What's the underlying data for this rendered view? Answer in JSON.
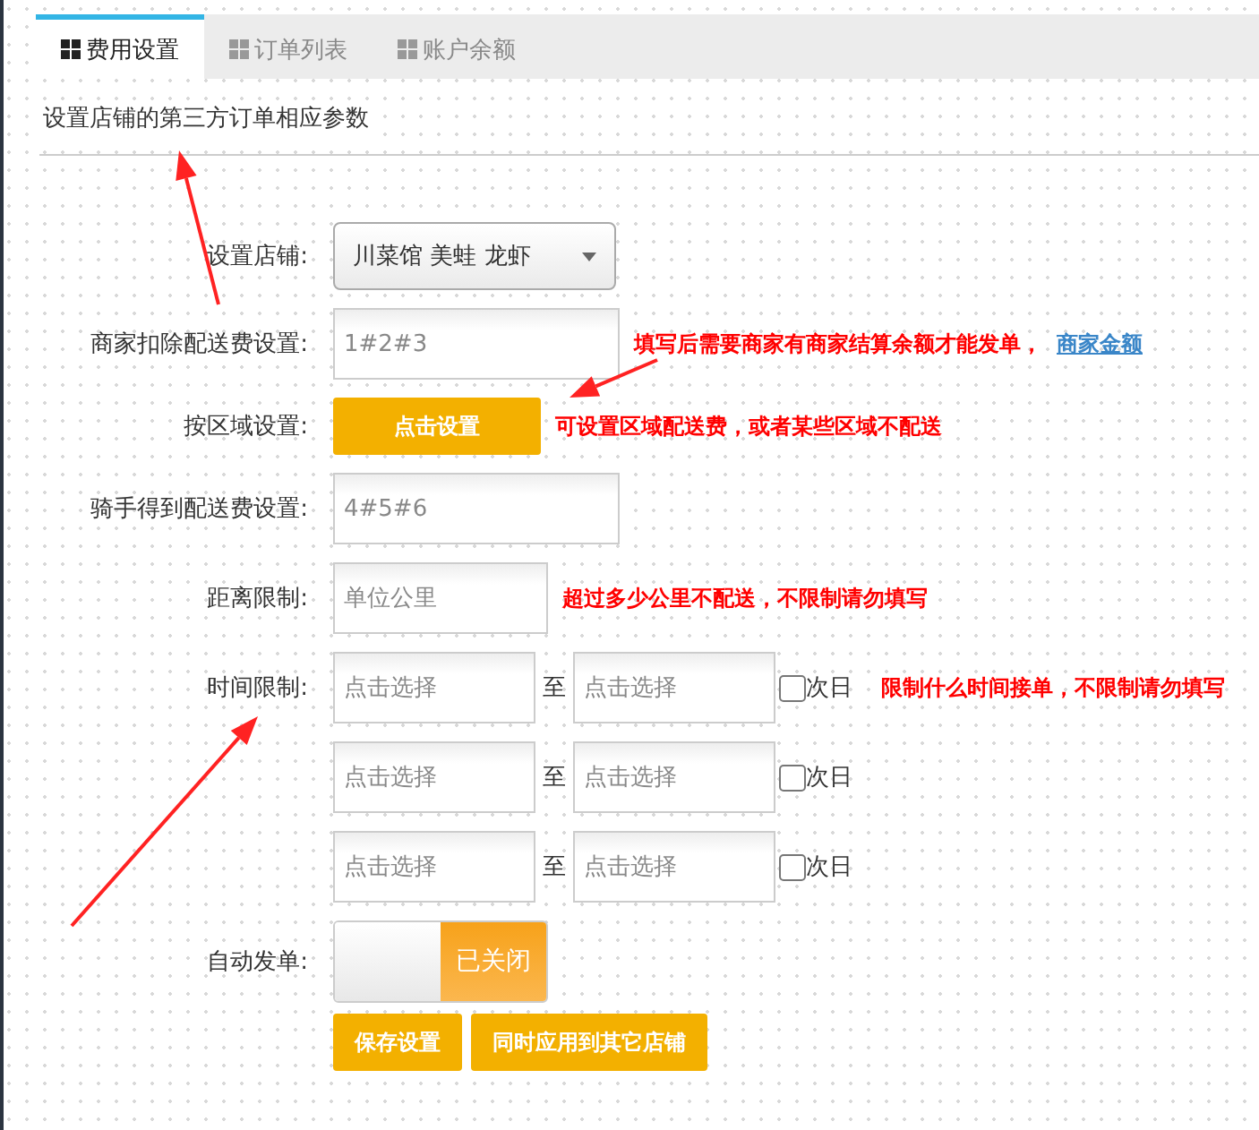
{
  "tabs": [
    {
      "label": "费用设置",
      "selected": true
    },
    {
      "label": "订单列表",
      "selected": false
    },
    {
      "label": "账户余额",
      "selected": false
    }
  ],
  "description": "设置店铺的第三方订单相应参数",
  "form": [
    {
      "kind": "select",
      "label": "设置店铺:",
      "value": "川菜馆 美蛙 龙虾"
    },
    {
      "kind": "input",
      "label": "商家扣除配送费设置:",
      "placeholder": "1#2#3",
      "wide": true,
      "note": "填写后需要商家有商家结算余额才能发单，",
      "link": "商家金额"
    },
    {
      "kind": "button",
      "label": "按区域设置:",
      "button": "点击设置",
      "note": "可设置区域配送费，或者某些区域不配送"
    },
    {
      "kind": "input",
      "label": "骑手得到配送费设置:",
      "placeholder": "4#5#6",
      "wide": true
    },
    {
      "kind": "input",
      "label": "距离限制:",
      "placeholder": "单位公里",
      "wide": false,
      "note": "超过多少公里不配送，不限制请勿填写"
    },
    {
      "kind": "time",
      "label": "时间限制:",
      "from": {
        "placeholder": "点击选择"
      },
      "to_word": "至",
      "to": {
        "placeholder": "点击选择"
      },
      "next_day": "次日",
      "checked": false,
      "note": "限制什么时间接单，不限制请勿填写"
    },
    {
      "kind": "time",
      "from": {
        "placeholder": "点击选择"
      },
      "to_word": "至",
      "to": {
        "placeholder": "点击选择"
      },
      "next_day": "次日",
      "checked": false
    },
    {
      "kind": "time",
      "from": {
        "placeholder": "点击选择"
      },
      "to_word": "至",
      "to": {
        "placeholder": "点击选择"
      },
      "next_day": "次日",
      "checked": false
    },
    {
      "kind": "toggle",
      "label": "自动发单:",
      "on": false,
      "text": "已关闭"
    }
  ],
  "actions": [
    "保存设置",
    "同时应用到其它店铺"
  ]
}
